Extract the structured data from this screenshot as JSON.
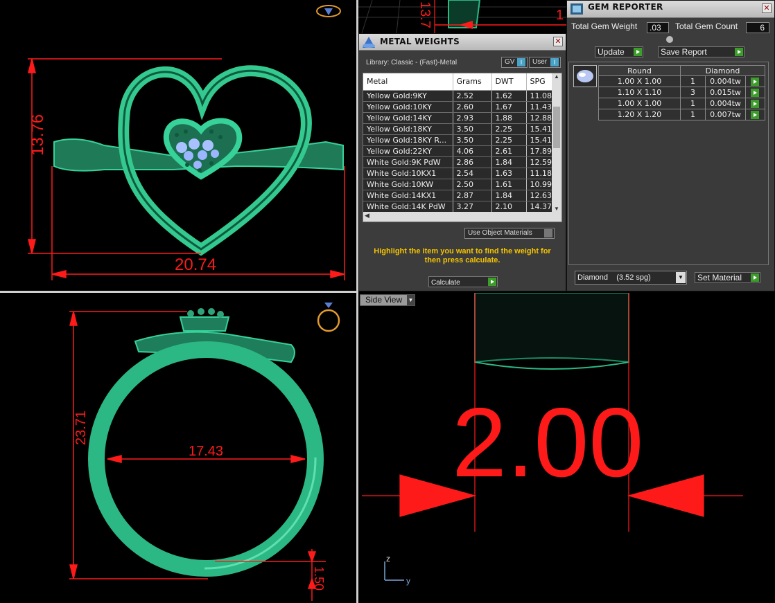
{
  "colors": {
    "dimension_red": "#ff1a1a",
    "model_green": "#2fbf8a",
    "panel_bg": "#3a3a3a",
    "highlight_text": "#f5c400",
    "go_button": "#3c9d2a"
  },
  "viewports": {
    "top_left": {
      "dim_height": "13.76",
      "dim_width": "20.74"
    },
    "bottom_left": {
      "dim_height": "23.71",
      "dim_inner": "17.43",
      "dim_shank": "1.50"
    },
    "bottom_right": {
      "view_label": "Side View",
      "dim_value": "2.00",
      "axis_z": "z",
      "axis_y": "y"
    },
    "top_middle": {
      "dim_partial": "13.7",
      "dim_partial2": "1"
    }
  },
  "metal_weights": {
    "title": "METAL WEIGHTS",
    "library_label": "Library: Classic - (Fast)-Metal",
    "gv_label": "GV",
    "user_label": "User",
    "toggle_glyph": "I",
    "columns": [
      "Metal",
      "Grams",
      "DWT",
      "SPG"
    ],
    "rows": [
      [
        "Yellow Gold:9KY",
        "2.52",
        "1.62",
        "11.08"
      ],
      [
        "Yellow Gold:10KY",
        "2.60",
        "1.67",
        "11.43"
      ],
      [
        "Yellow Gold:14KY",
        "2.93",
        "1.88",
        "12.88"
      ],
      [
        "Yellow Gold:18KY",
        "3.50",
        "2.25",
        "15.41"
      ],
      [
        "Yellow Gold:18KY R...",
        "3.50",
        "2.25",
        "15.41"
      ],
      [
        "Yellow Gold:22KY",
        "4.06",
        "2.61",
        "17.89"
      ],
      [
        "White Gold:9K PdW",
        "2.86",
        "1.84",
        "12.59"
      ],
      [
        "White Gold:10KX1",
        "2.54",
        "1.63",
        "11.18"
      ],
      [
        "White Gold:10KW",
        "2.50",
        "1.61",
        "10.99"
      ],
      [
        "White Gold:14KX1",
        "2.87",
        "1.84",
        "12.63"
      ],
      [
        "White Gold:14K PdW",
        "3.27",
        "2.10",
        "14.37"
      ]
    ],
    "use_object_materials": "Use Object Materials",
    "hint": "Highlight the item you want to find the weight for then press calculate.",
    "calculate_label": "Calculate"
  },
  "gem_reporter": {
    "title": "GEM REPORTER",
    "total_weight_label": "Total Gem Weight",
    "total_weight_value": ".03",
    "total_count_label": "Total Gem Count",
    "total_count_value": "6",
    "update_label": "Update",
    "save_report_label": "Save Report",
    "col_shape": "Round",
    "col_material": "Diamond",
    "rows": [
      [
        "1.00 X 1.00",
        "1",
        "0.004tw"
      ],
      [
        "1.10 X 1.10",
        "3",
        "0.015tw"
      ],
      [
        "1.00 X 1.00",
        "1",
        "0.004tw"
      ],
      [
        "1.20 X 1.20",
        "1",
        "0.007tw"
      ]
    ],
    "material_select": "Diamond    (3.52 spg)",
    "set_material_label": "Set Material"
  }
}
